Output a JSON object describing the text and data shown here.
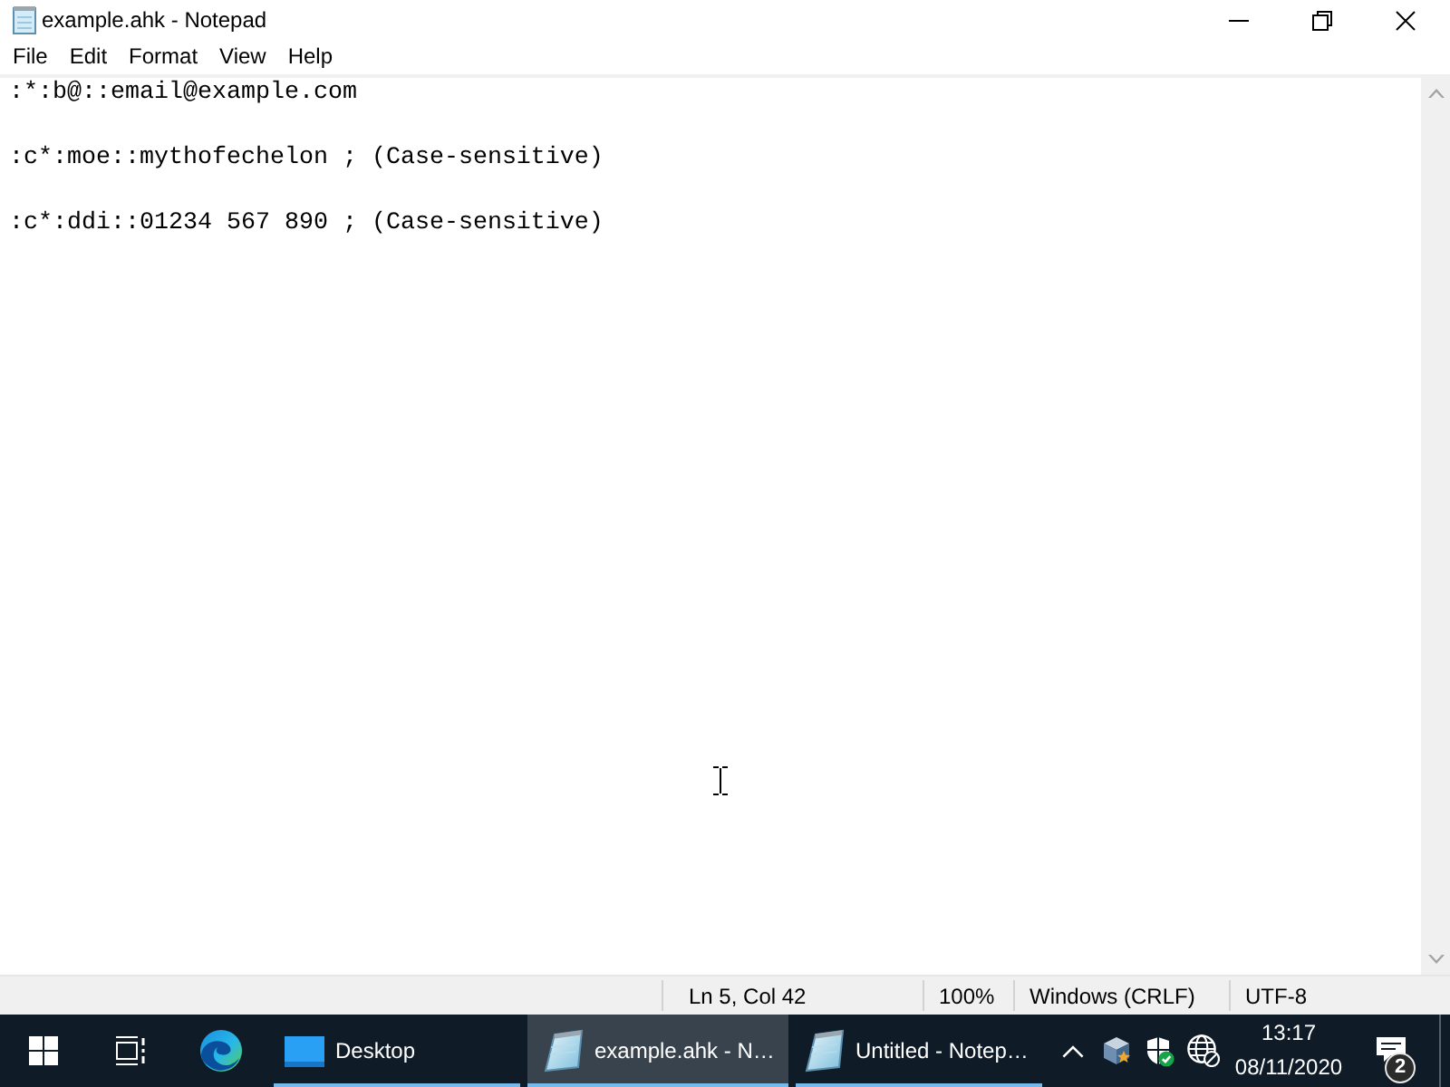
{
  "window": {
    "title": "example.ahk - Notepad"
  },
  "menu": [
    "File",
    "Edit",
    "Format",
    "View",
    "Help"
  ],
  "editor": {
    "lines": [
      ":*:b@::email@example.com",
      ":c*:moe::mythofechelon ; (Case-sensitive)",
      ":c*:ddi::01234 567 890 ; (Case-sensitive)"
    ]
  },
  "status_bar": {
    "position": "Ln 5, Col 42",
    "zoom": "100%",
    "line_ending": "Windows (CRLF)",
    "encoding": "UTF-8"
  },
  "taskbar": {
    "buttons": [
      {
        "kind": "explorer",
        "label": "Desktop",
        "selected": false
      },
      {
        "kind": "notepad",
        "label": "example.ahk - N…",
        "selected": true
      },
      {
        "kind": "notepad",
        "label": "Untitled - Notep…",
        "selected": false
      }
    ],
    "clock": {
      "time": "13:17",
      "date": "08/11/2020"
    },
    "notifications": {
      "count": "2"
    }
  }
}
